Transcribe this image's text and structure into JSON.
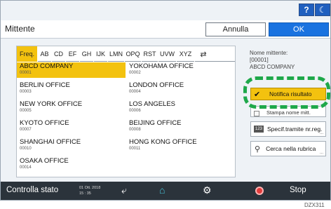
{
  "top": {
    "help_label": "?",
    "mode_icon": "moon-icon"
  },
  "header": {
    "title": "Mittente",
    "cancel_label": "Annulla",
    "ok_label": "OK"
  },
  "tabs": [
    "Freq.",
    "AB",
    "CD",
    "EF",
    "GH",
    "IJK",
    "LMN",
    "OPQ",
    "RST",
    "UVW",
    "XYZ"
  ],
  "tabs_refresh_icon": "refresh-icon",
  "entries": [
    {
      "name": "ABCD COMPANY",
      "number": "00001",
      "selected": true
    },
    {
      "name": "YOKOHAMA OFFICE",
      "number": "00002"
    },
    {
      "name": "BERLIN OFFICE",
      "number": "00003"
    },
    {
      "name": "LONDON OFFICE",
      "number": "00004"
    },
    {
      "name": "NEW YORK OFFICE",
      "number": "00005"
    },
    {
      "name": "LOS ANGELES",
      "number": "00006"
    },
    {
      "name": "KYOTO OFFICE",
      "number": "00007"
    },
    {
      "name": "BEIJING OFFICE",
      "number": "00008"
    },
    {
      "name": "SHANGHAI  OFFICE",
      "number": "00010"
    },
    {
      "name": "HONG KONG OFFICE",
      "number": "00011"
    },
    {
      "name": "OSAKA OFFICE",
      "number": "00014"
    }
  ],
  "sender": {
    "label": "Nome mittente:",
    "number": "[00001]",
    "name": "ABCD COMPANY"
  },
  "buttons": {
    "notifica": "Notifica risultato",
    "stampa": "Stampa nome mitt.",
    "specif": "Specif.tramite nr.reg.",
    "cerca": "Cerca nella rubrica",
    "specif_icon_text": "123"
  },
  "status": {
    "text": "Controlla stato",
    "date": "01 Ott. 2018",
    "time": "15 : 35",
    "stop": "Stop"
  },
  "caption": "DZX311",
  "colors": {
    "accent_yellow": "#f3c20f",
    "ok_blue": "#1a73e0",
    "highlight_green": "#1ea84a",
    "statusbar": "#2b333b"
  }
}
